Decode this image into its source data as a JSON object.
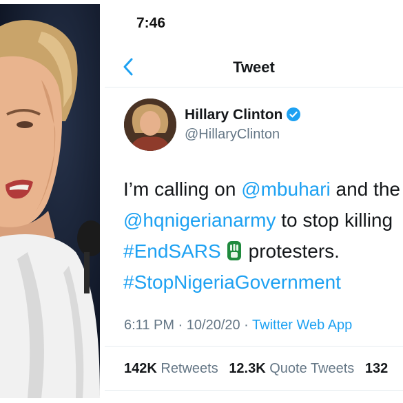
{
  "status_bar": {
    "time": "7:46"
  },
  "nav": {
    "title": "Tweet",
    "back_icon": "chevron-left-icon"
  },
  "tweet": {
    "display_name": "Hillary Clinton",
    "handle": "@HillaryClinton",
    "verified": true,
    "text": {
      "l1_a": "I’m calling on ",
      "l1_mention": "@mbuhari",
      "l1_b": " and the",
      "l2_mention": "@hqnigerianarmy",
      "l2_b": " to stop killing",
      "l3_hashtag": "#EndSARS",
      "l3_b": "protesters.",
      "l4_hashtag": "#StopNigeriaGovernment"
    },
    "meta": {
      "time": "6:11 PM · 10/20/20 · ",
      "source": "Twitter Web App"
    },
    "stats": {
      "retweets_count": "142K",
      "retweets_label": " Retweets",
      "quotes_count": "12.3K",
      "quotes_label": " Quote Tweets",
      "likes_count": "132"
    }
  },
  "colors": {
    "link": "#1da1f2",
    "text": "#14171a",
    "muted": "#657786"
  }
}
